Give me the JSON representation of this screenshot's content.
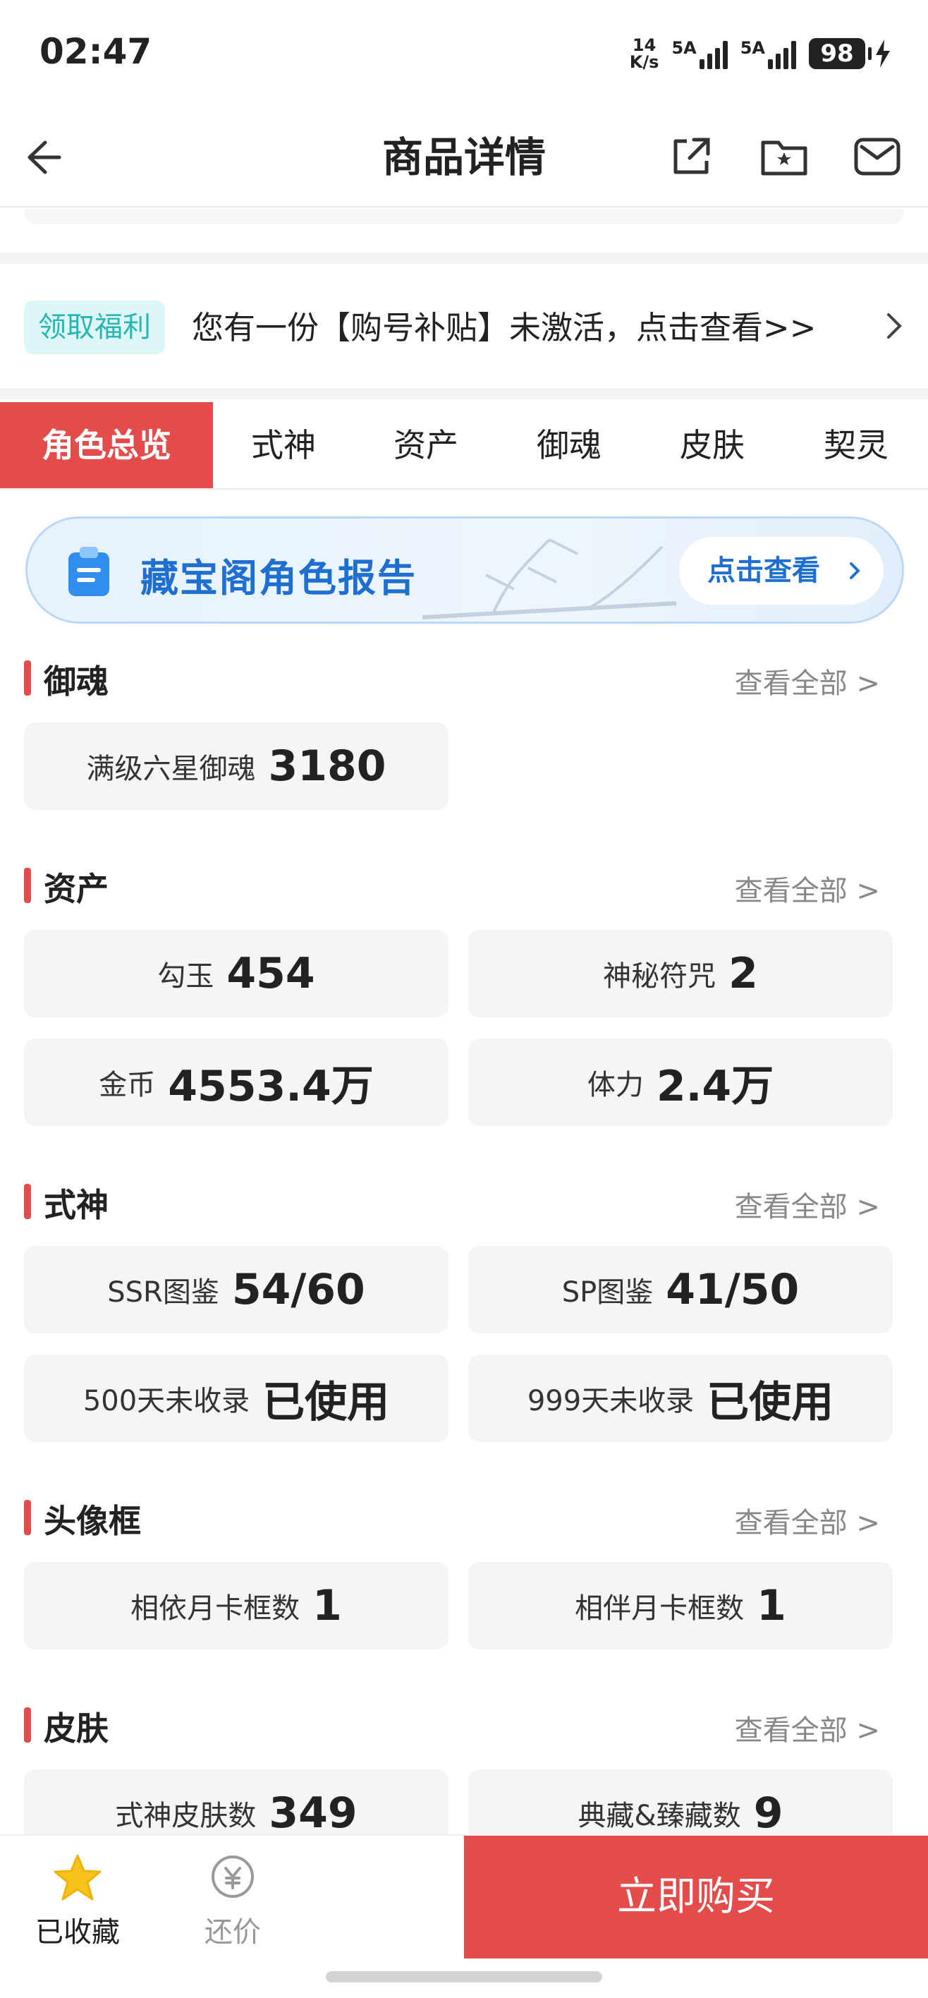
{
  "status": {
    "time": "02:47",
    "net_speed_value": "14",
    "net_speed_unit": "K/s",
    "sim1": "5A",
    "sim2": "5A",
    "battery": "98"
  },
  "nav": {
    "title": "商品详情"
  },
  "benefit": {
    "tag": "领取福利",
    "text": "您有一份【购号补贴】未激活，点击查看>>"
  },
  "tabs": [
    {
      "label": "角色总览",
      "active": true
    },
    {
      "label": "式神",
      "active": false
    },
    {
      "label": "资产",
      "active": false
    },
    {
      "label": "御魂",
      "active": false
    },
    {
      "label": "皮肤",
      "active": false
    },
    {
      "label": "契灵",
      "active": false
    }
  ],
  "report": {
    "title": "藏宝阁角色报告",
    "button": "点击查看"
  },
  "sections": {
    "yuhun": {
      "title": "御魂",
      "more": "查看全部 >",
      "items": [
        {
          "k": "满级六星御魂",
          "v": "3180"
        }
      ]
    },
    "assets": {
      "title": "资产",
      "more": "查看全部 >",
      "items": [
        {
          "k": "勾玉",
          "v": "454"
        },
        {
          "k": "神秘符咒",
          "v": "2"
        },
        {
          "k": "金币",
          "v": "4553.4万"
        },
        {
          "k": "体力",
          "v": "2.4万"
        }
      ]
    },
    "shikigami": {
      "title": "式神",
      "more": "查看全部 >",
      "items": [
        {
          "k": "SSR图鉴",
          "v": "54/60"
        },
        {
          "k": "SP图鉴",
          "v": "41/50"
        },
        {
          "k": "500天未收录",
          "v": "已使用"
        },
        {
          "k": "999天未收录",
          "v": "已使用"
        }
      ]
    },
    "frames": {
      "title": "头像框",
      "more": "查看全部 >",
      "items": [
        {
          "k": "相依月卡框数",
          "v": "1"
        },
        {
          "k": "相伴月卡框数",
          "v": "1"
        }
      ]
    },
    "skins": {
      "title": "皮肤",
      "more": "查看全部 >",
      "items": [
        {
          "k": "式神皮肤数",
          "v": "349"
        },
        {
          "k": "典藏&臻藏数",
          "v": "9"
        }
      ]
    }
  },
  "bottom": {
    "favorite": "已收藏",
    "bargain": "还价",
    "buy": "立即购买"
  },
  "colors": {
    "accent": "#e44b4b",
    "teal": "#27b7b0",
    "blue": "#1f6fd0",
    "star": "#f6c21b"
  }
}
